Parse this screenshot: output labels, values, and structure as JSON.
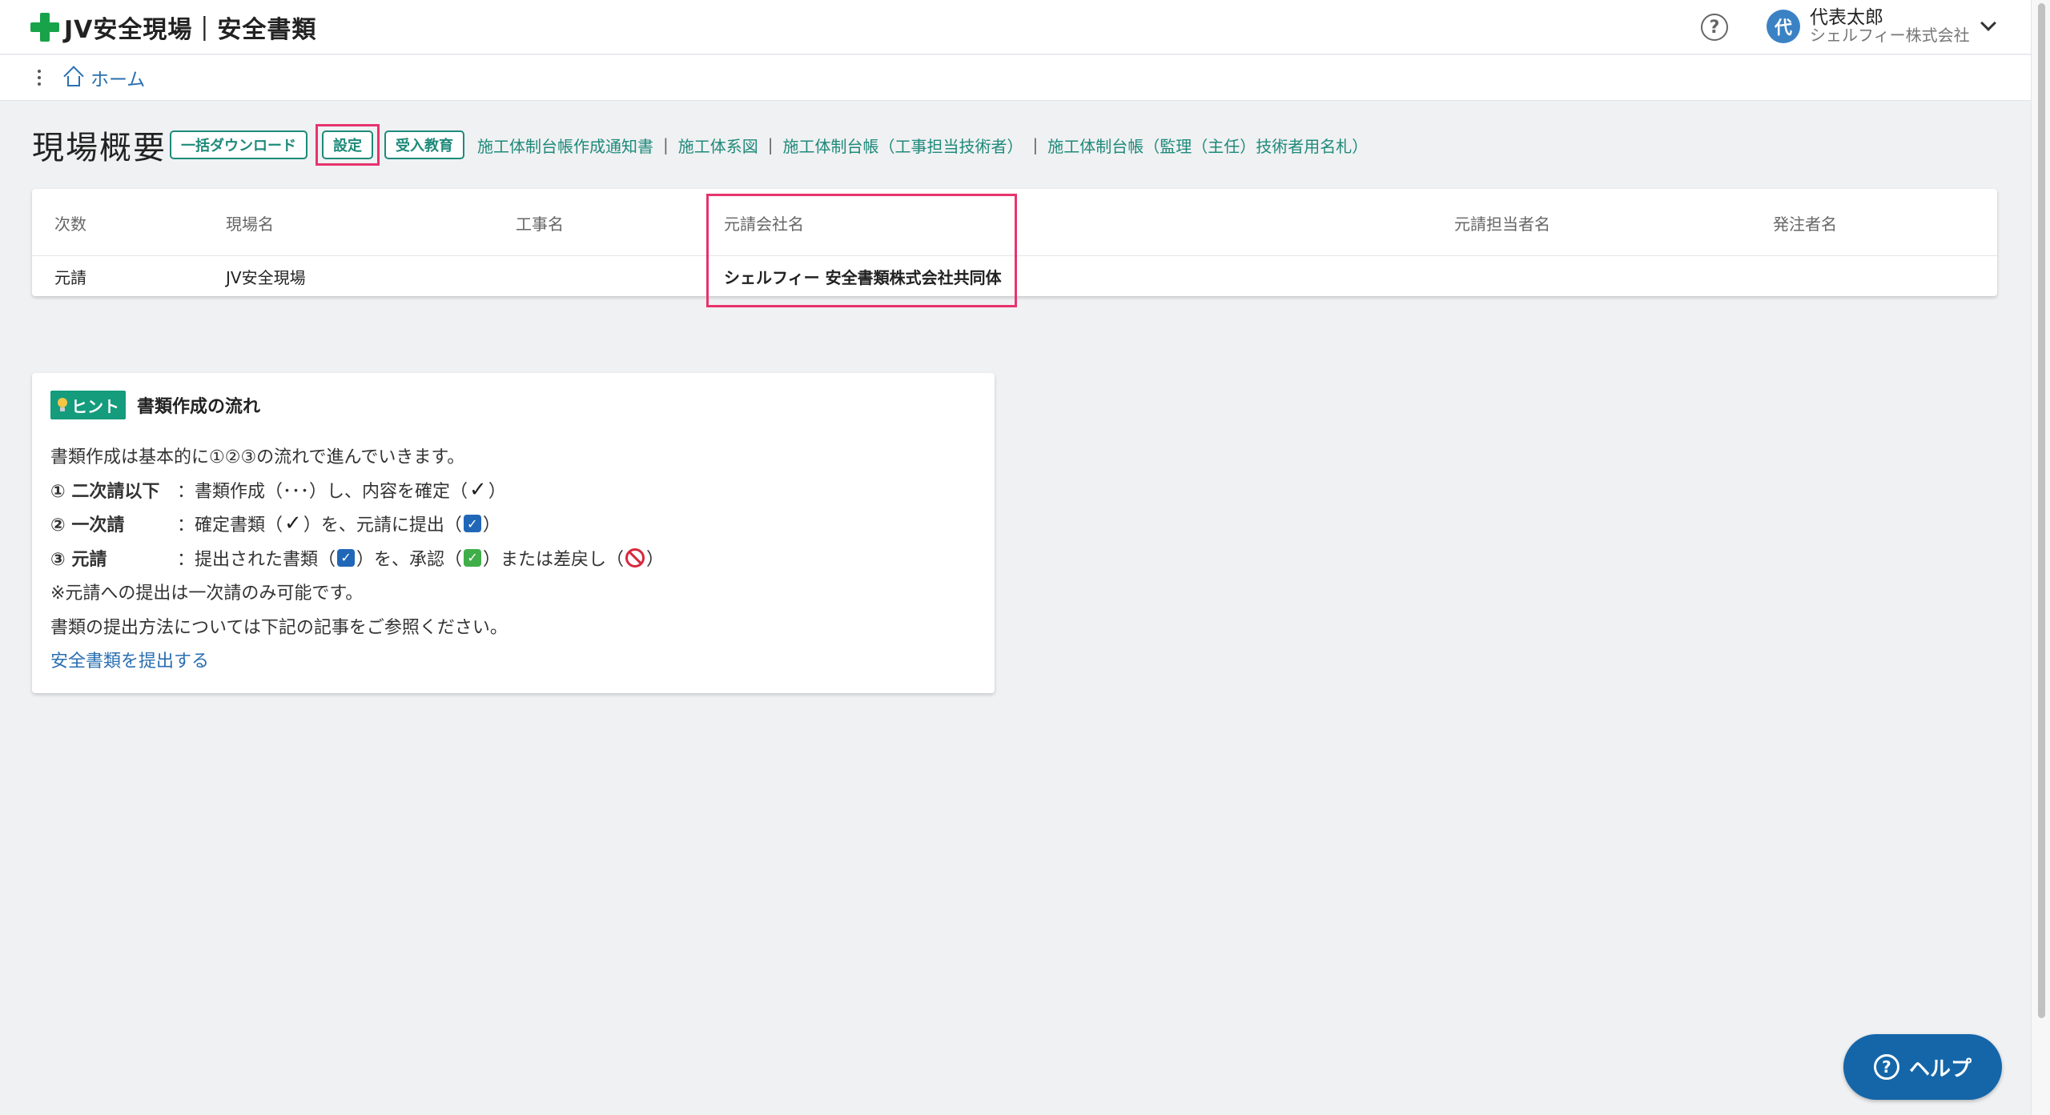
{
  "header": {
    "app_title": "JV安全現場｜安全書類",
    "help_icon_glyph": "?",
    "user": {
      "avatar_char": "代",
      "name": "代表太郎",
      "company": "シェルフィー株式会社"
    }
  },
  "breadcrumb": {
    "home_label": "ホーム"
  },
  "page": {
    "title": "現場概要",
    "buttons": {
      "download": "一括ダウンロード",
      "settings": "設定",
      "education": "受入教育"
    },
    "doc_links": [
      "施工体制台帳作成通知書",
      "施工体系図",
      "施工体制台帳（工事担当技術者）",
      "施工体制台帳（監理（主任）技術者用名札）"
    ],
    "doc_link_separator": "|"
  },
  "table": {
    "columns": [
      "次数",
      "現場名",
      "工事名",
      "元請会社名",
      "元請担当者名",
      "発注者名"
    ],
    "rows": [
      [
        "元請",
        "JV安全現場",
        "",
        "シェルフィー 安全書類株式会社共同体",
        "",
        ""
      ]
    ]
  },
  "hint": {
    "badge": "ヒント",
    "title": "書類作成の流れ",
    "intro": "書類作成は基本的に①②③の流れで進んでいきます。",
    "step1": {
      "num": "①",
      "label": "二次請以下",
      "text_a": "：書類作成（･･･）し、内容を確定（",
      "text_b": "）"
    },
    "step2": {
      "num": "②",
      "label": "一次請",
      "text_a": "：確定書類（",
      "text_b": "）を、元請に提出（",
      "text_c": "）"
    },
    "step3": {
      "num": "③",
      "label": "元請",
      "text_a": "：提出された書類（",
      "text_b": "）を、承認（",
      "text_c": "）または差戻し（",
      "text_d": "）"
    },
    "note": "※元請への提出は一次請のみ可能です。",
    "reference": "書類の提出方法については下記の記事をご参照ください。",
    "link": "安全書類を提出する"
  },
  "help_button": {
    "label": "ヘルプ"
  },
  "colors": {
    "brand_green": "#18a34a",
    "teal": "#1e8a7a",
    "link_blue": "#2a6fb0",
    "highlight_pink": "#e8336d",
    "help_blue": "#1466a8"
  }
}
